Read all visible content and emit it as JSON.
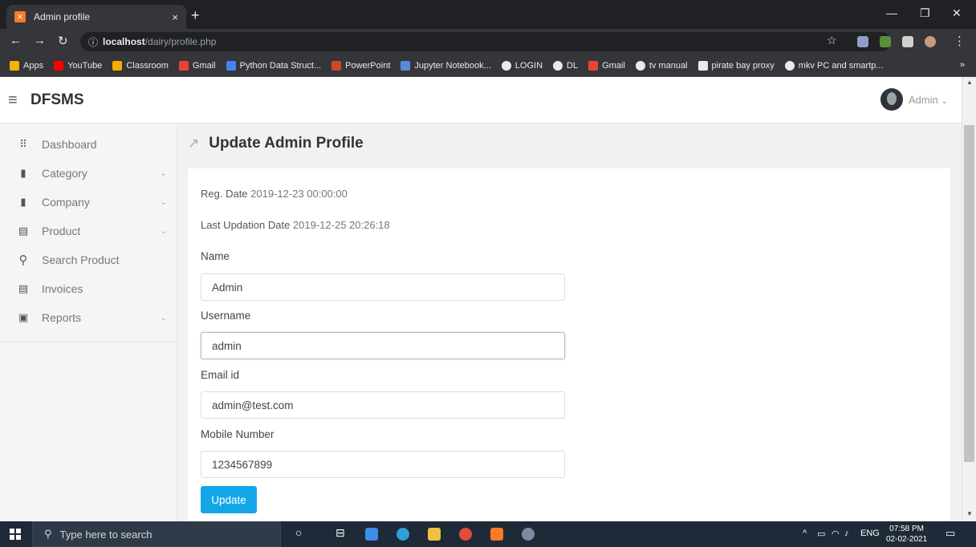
{
  "browser": {
    "tab_title": "Admin profile",
    "tab_close": "×",
    "new_tab": "+",
    "url_host": "localhost",
    "url_path": "/dairy/profile.php",
    "bookmarks": [
      {
        "label": "Apps",
        "color": "#f4b400"
      },
      {
        "label": "YouTube",
        "color": "#ff0000"
      },
      {
        "label": "Classroom",
        "color": "#f9ab00"
      },
      {
        "label": "Gmail",
        "color": "#ea4335"
      },
      {
        "label": "Python Data Struct...",
        "color": "#4285f4"
      },
      {
        "label": "PowerPoint",
        "color": "#d24726"
      },
      {
        "label": "Jupyter Notebook...",
        "color": "#5c8bd6"
      },
      {
        "label": "LOGIN",
        "color": "#e8eaed"
      },
      {
        "label": "DL",
        "color": "#e8eaed"
      },
      {
        "label": "Gmail",
        "color": "#ea4335"
      },
      {
        "label": "tv manual",
        "color": "#e8eaed"
      },
      {
        "label": "pirate bay proxy",
        "color": "#e8eaed"
      },
      {
        "label": "mkv PC and smartp...",
        "color": "#e8eaed"
      }
    ],
    "bookmarks_more": "»"
  },
  "app": {
    "brand": "DFSMS",
    "user_name": "Admin",
    "user_chevron": "⌄"
  },
  "sidebar": {
    "items": [
      {
        "label": "Dashboard",
        "icon": "dashboard-icon",
        "glyph": "⠿",
        "chevron": ""
      },
      {
        "label": "Category",
        "icon": "file-icon",
        "glyph": "▮",
        "chevron": "⌄"
      },
      {
        "label": "Company",
        "icon": "file-icon",
        "glyph": "▮",
        "chevron": "⌄"
      },
      {
        "label": "Product",
        "icon": "list-icon",
        "glyph": "▤",
        "chevron": "⌄"
      },
      {
        "label": "Search Product",
        "icon": "search-icon",
        "glyph": "🔍",
        "chevron": ""
      },
      {
        "label": "Invoices",
        "icon": "list-icon",
        "glyph": "▤",
        "chevron": ""
      },
      {
        "label": "Reports",
        "icon": "report-icon",
        "glyph": "▣",
        "chevron": "⌄"
      }
    ]
  },
  "page": {
    "title": "Update Admin Profile",
    "reg_date_label": "Reg. Date",
    "reg_date_value": "2019-12-23 00:00:00",
    "last_update_label": "Last Updation Date",
    "last_update_value": "2019-12-25 20:26:18",
    "fields": [
      {
        "label": "Name",
        "value": "Admin"
      },
      {
        "label": "Username",
        "value": "admin"
      },
      {
        "label": "Email id",
        "value": "admin@test.com"
      },
      {
        "label": "Mobile Number",
        "value": "1234567899"
      }
    ],
    "update_button": "Update"
  },
  "taskbar": {
    "search_placeholder": "Type here to search",
    "language": "ENG",
    "time": "07:58 PM",
    "date": "02-02-2021"
  },
  "colors": {
    "accent": "#13a6e8",
    "chrome_dark": "#202124",
    "taskbar": "#1f2a38"
  }
}
